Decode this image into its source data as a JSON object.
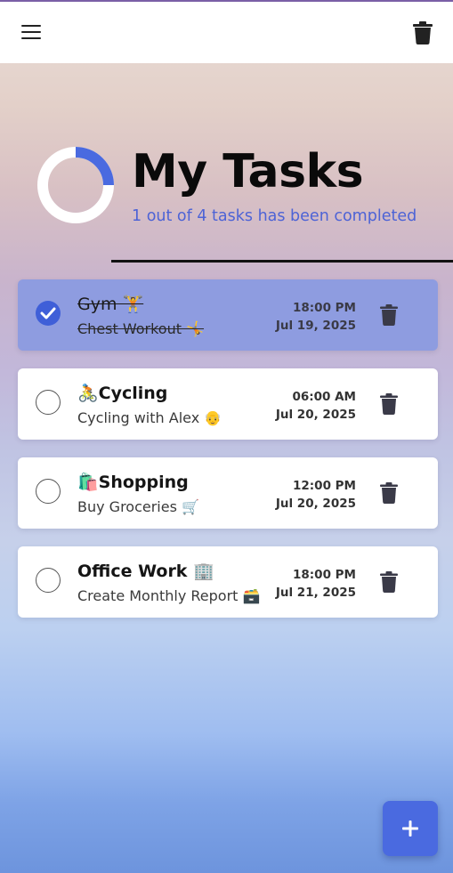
{
  "app": {
    "title": "My Tasks",
    "progress_text": "1 out of 4 tasks has been completed",
    "completed": 1,
    "total": 4,
    "accent_color": "#4a6ae0"
  },
  "appbar": {
    "menu_icon": "menu-icon",
    "trash_icon": "trash-icon"
  },
  "tasks": [
    {
      "title": "Gym 🏋️",
      "description": "Chest Workout 🤸",
      "time": "18:00 PM",
      "date": "Jul 19, 2025",
      "done": true
    },
    {
      "title": "🚴Cycling",
      "description": "Cycling with Alex 👴",
      "time": "06:00 AM",
      "date": "Jul 20, 2025",
      "done": false
    },
    {
      "title": "🛍️Shopping",
      "description": "Buy Groceries 🛒",
      "time": "12:00 PM",
      "date": "Jul 20, 2025",
      "done": false
    },
    {
      "title": "Office Work 🏢",
      "description": "Create Monthly Report 🗃️",
      "time": "18:00 PM",
      "date": "Jul 21, 2025",
      "done": false
    }
  ],
  "fab": {
    "icon": "plus-icon"
  }
}
